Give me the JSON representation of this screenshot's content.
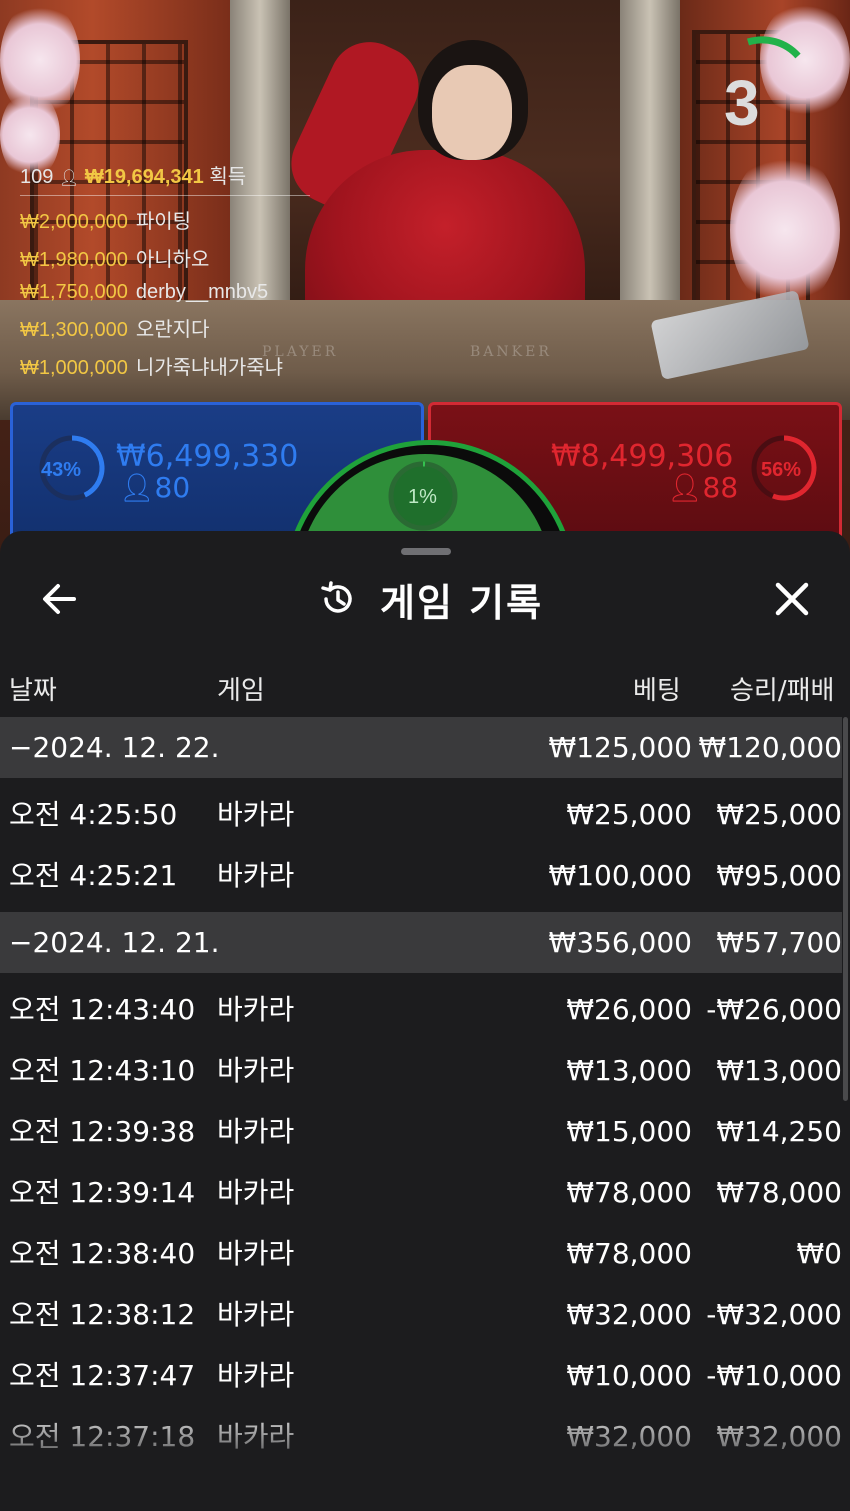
{
  "countdown": "3",
  "winners": {
    "count": "109",
    "total": "₩19,694,341",
    "suffix": "획득",
    "list": [
      {
        "amount": "₩2,000,000",
        "name": "파이팅"
      },
      {
        "amount": "₩1,980,000",
        "name": "아니하오"
      },
      {
        "amount": "₩1,750,000",
        "name": "derby__mnbv5"
      },
      {
        "amount": "₩1,300,000",
        "name": "오란지다"
      },
      {
        "amount": "₩1,000,000",
        "name": "니가죽냐내가죽냐"
      }
    ]
  },
  "table_labels": {
    "player": "PLAYER",
    "banker": "BANKER"
  },
  "bets": {
    "player": {
      "percent": "43%",
      "amount": "₩6,499,330",
      "players": "80",
      "color": "#2f7cf0"
    },
    "banker": {
      "percent": "56%",
      "amount": "₩8,499,306",
      "players": "88",
      "color": "#e0262f"
    },
    "tie": {
      "percent": "1%",
      "color": "#34c24f"
    }
  },
  "sheet": {
    "title": "게임 기록",
    "columns": {
      "date": "날짜",
      "game": "게임",
      "bet": "베팅",
      "result": "승리/패배"
    },
    "groups": [
      {
        "date": "−2024. 12. 22.",
        "bet_total": "₩125,000",
        "result_total": "₩120,000",
        "rows": [
          {
            "time": "오전 4:25:50",
            "game": "바카라",
            "bet": "₩25,000",
            "result": "₩25,000"
          },
          {
            "time": "오전 4:25:21",
            "game": "바카라",
            "bet": "₩100,000",
            "result": "₩95,000"
          }
        ]
      },
      {
        "date": "−2024. 12. 21.",
        "bet_total": "₩356,000",
        "result_total": "₩57,700",
        "rows": [
          {
            "time": "오전 12:43:40",
            "game": "바카라",
            "bet": "₩26,000",
            "result": "-₩26,000"
          },
          {
            "time": "오전 12:43:10",
            "game": "바카라",
            "bet": "₩13,000",
            "result": "₩13,000"
          },
          {
            "time": "오전 12:39:38",
            "game": "바카라",
            "bet": "₩15,000",
            "result": "₩14,250"
          },
          {
            "time": "오전 12:39:14",
            "game": "바카라",
            "bet": "₩78,000",
            "result": "₩78,000"
          },
          {
            "time": "오전 12:38:40",
            "game": "바카라",
            "bet": "₩78,000",
            "result": "₩0"
          },
          {
            "time": "오전 12:38:12",
            "game": "바카라",
            "bet": "₩32,000",
            "result": "-₩32,000"
          },
          {
            "time": "오전 12:37:47",
            "game": "바카라",
            "bet": "₩10,000",
            "result": "-₩10,000"
          },
          {
            "time": "오전 12:37:18",
            "game": "바카라",
            "bet": "₩32,000",
            "result": "₩32,000"
          }
        ]
      }
    ]
  },
  "icons": {
    "back": "arrow-left-icon",
    "history": "history-icon",
    "close": "close-icon",
    "person": "person-icon"
  },
  "colors": {
    "accent_gold": "#f2c744",
    "sheet_bg": "#1c1c1e",
    "date_row_bg": "#3a3a3c"
  }
}
